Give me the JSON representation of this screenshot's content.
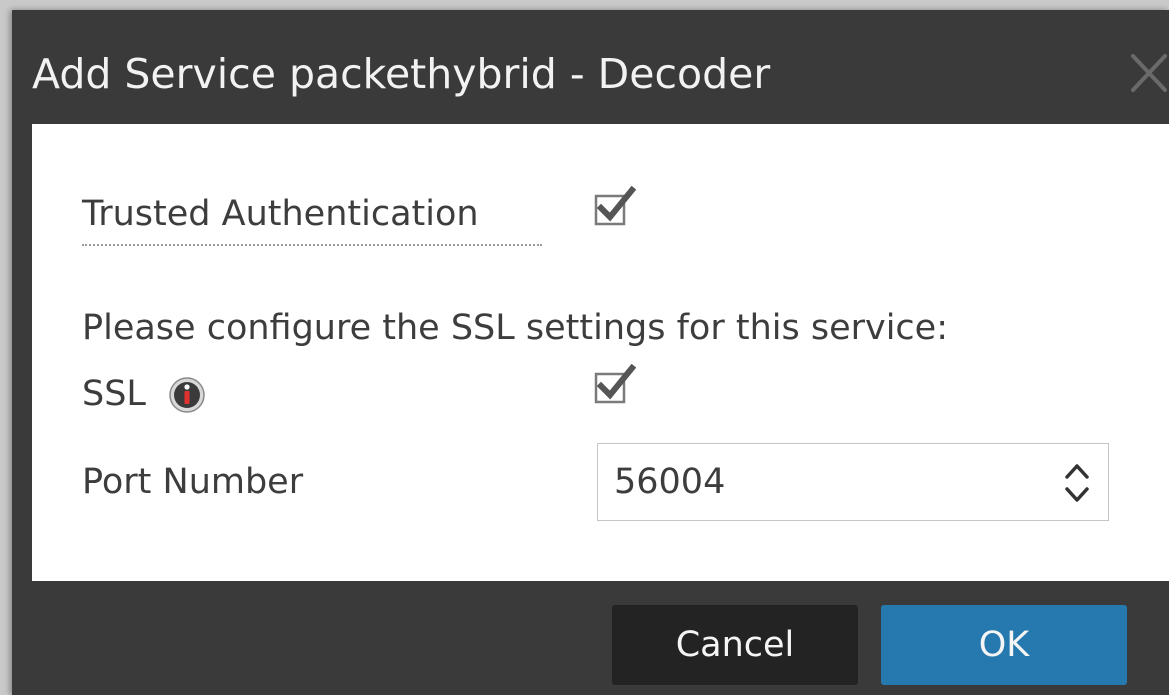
{
  "dialog": {
    "title": "Add Service packethybrid - Decoder",
    "close_icon": "close-icon"
  },
  "form": {
    "trusted_authentication": {
      "label": "Trusted Authentication",
      "checked": true
    },
    "ssl_note": "Please configure the SSL settings for this service:",
    "ssl": {
      "label": "SSL",
      "info_icon": "info-icon",
      "checked": true
    },
    "port_number": {
      "label": "Port Number",
      "value": "56004",
      "spinner_icon": "spinner-updown-icon"
    }
  },
  "buttons": {
    "cancel": "Cancel",
    "ok": "OK"
  },
  "colors": {
    "dialog_bg": "#3a3a3a",
    "content_bg": "#ffffff",
    "ok_button": "#2679ae",
    "cancel_button": "#232323"
  }
}
